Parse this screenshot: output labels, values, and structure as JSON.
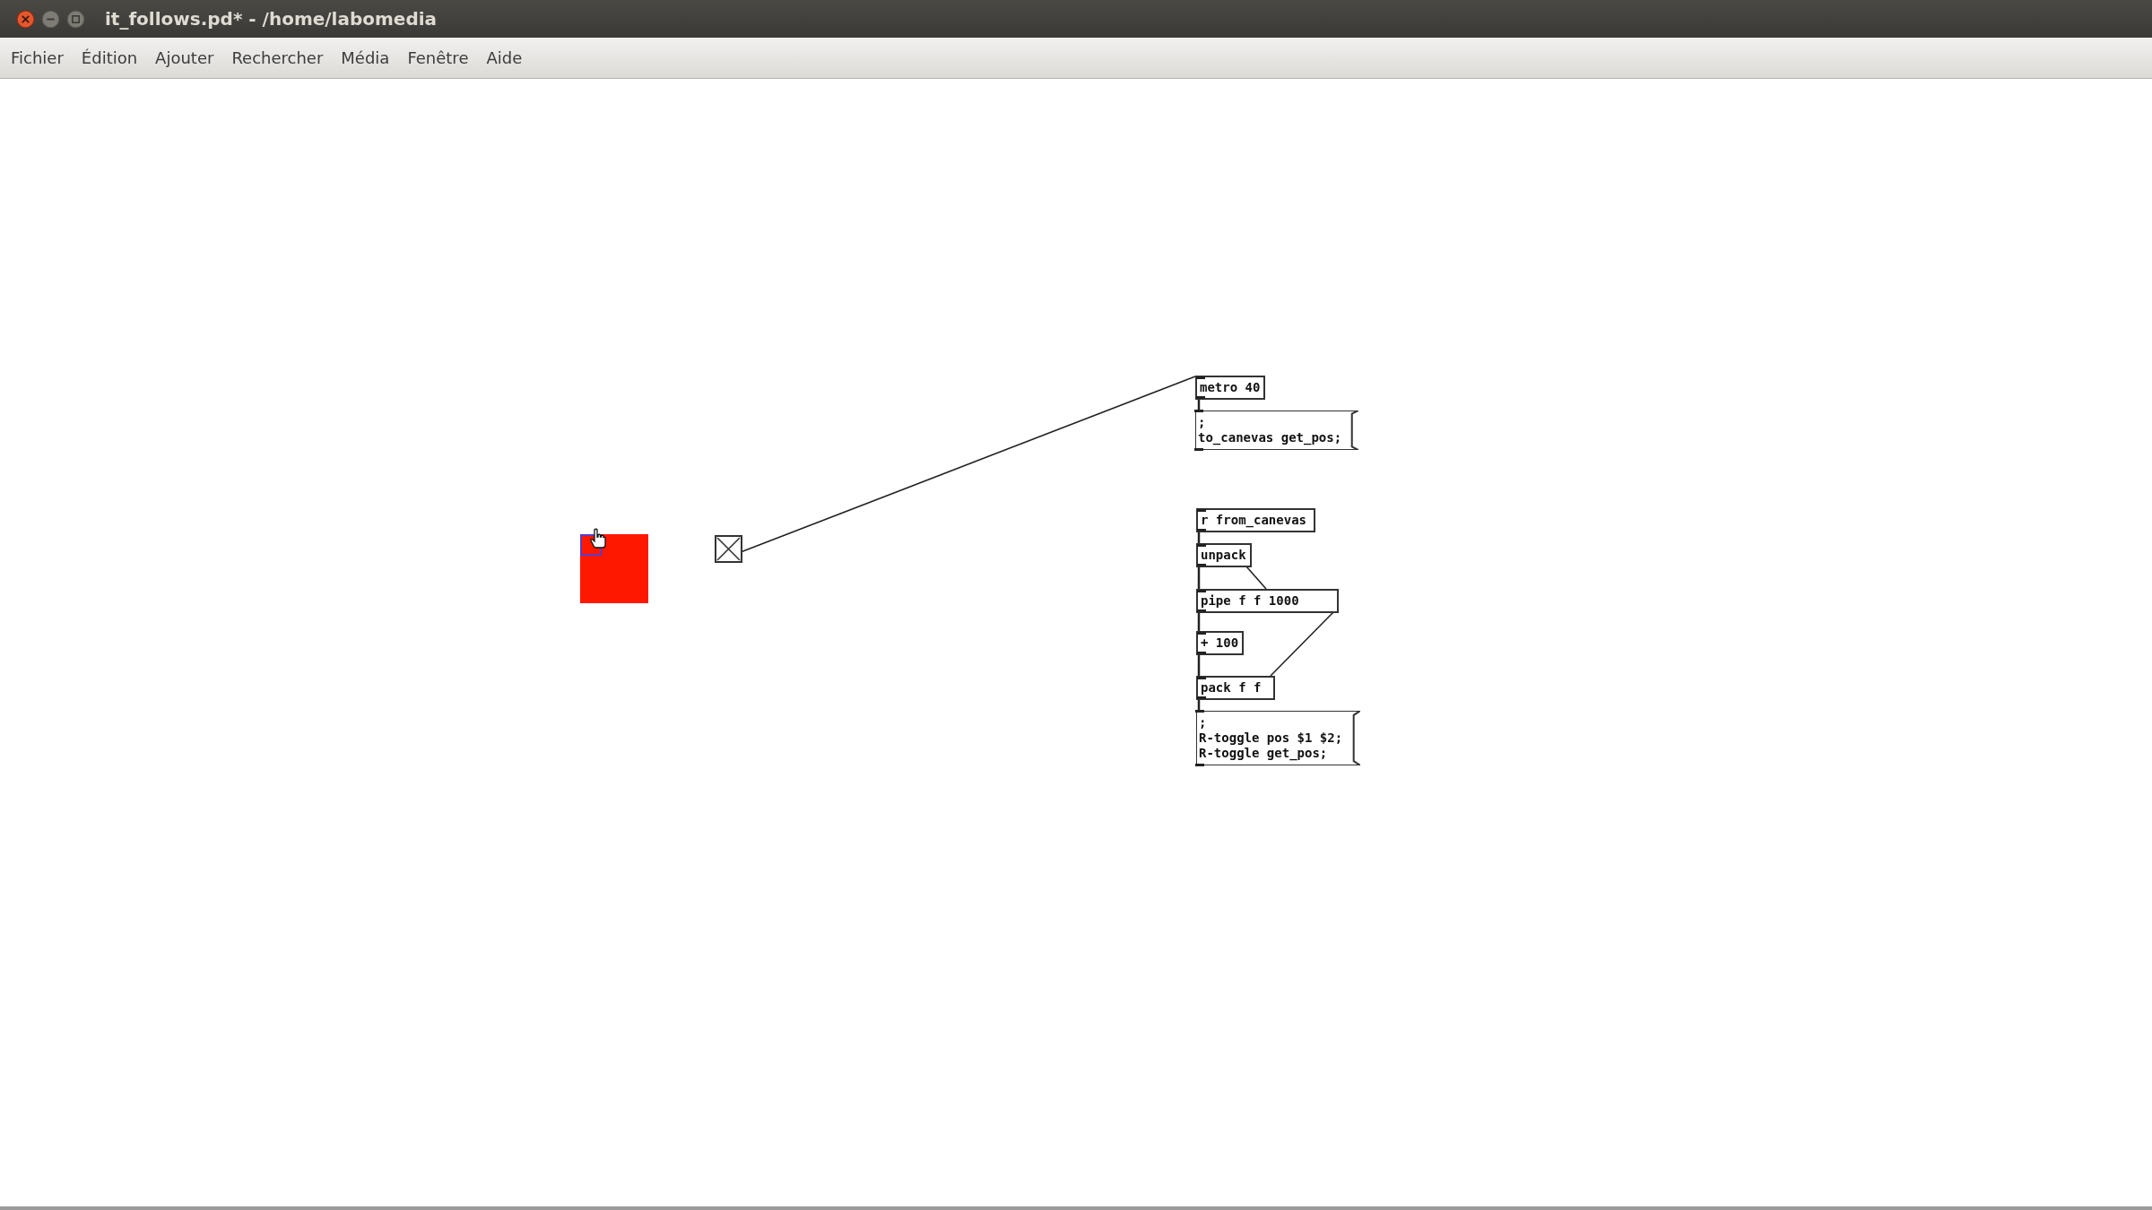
{
  "window": {
    "title": "it_follows.pd* - /home/labomedia"
  },
  "menu": [
    "Fichier",
    "Édition",
    "Ajouter",
    "Rechercher",
    "Média",
    "Fenêtre",
    "Aide"
  ],
  "canvas": {
    "toggle": {
      "checked": true
    },
    "boxes": [
      {
        "kind": "object",
        "lines": [
          "metro 40"
        ]
      },
      {
        "kind": "message",
        "lines": [
          ";",
          "to_canevas get_pos;"
        ]
      },
      {
        "kind": "object",
        "lines": [
          "r from_canevas"
        ]
      },
      {
        "kind": "object",
        "lines": [
          "unpack"
        ]
      },
      {
        "kind": "object",
        "lines": [
          "pipe f f 1000"
        ]
      },
      {
        "kind": "object",
        "lines": [
          "+ 100"
        ]
      },
      {
        "kind": "object",
        "lines": [
          "pack f f"
        ]
      },
      {
        "kind": "message",
        "lines": [
          ";",
          "R-toggle pos $1 $2;",
          "R-toggle get_pos;"
        ]
      }
    ]
  }
}
